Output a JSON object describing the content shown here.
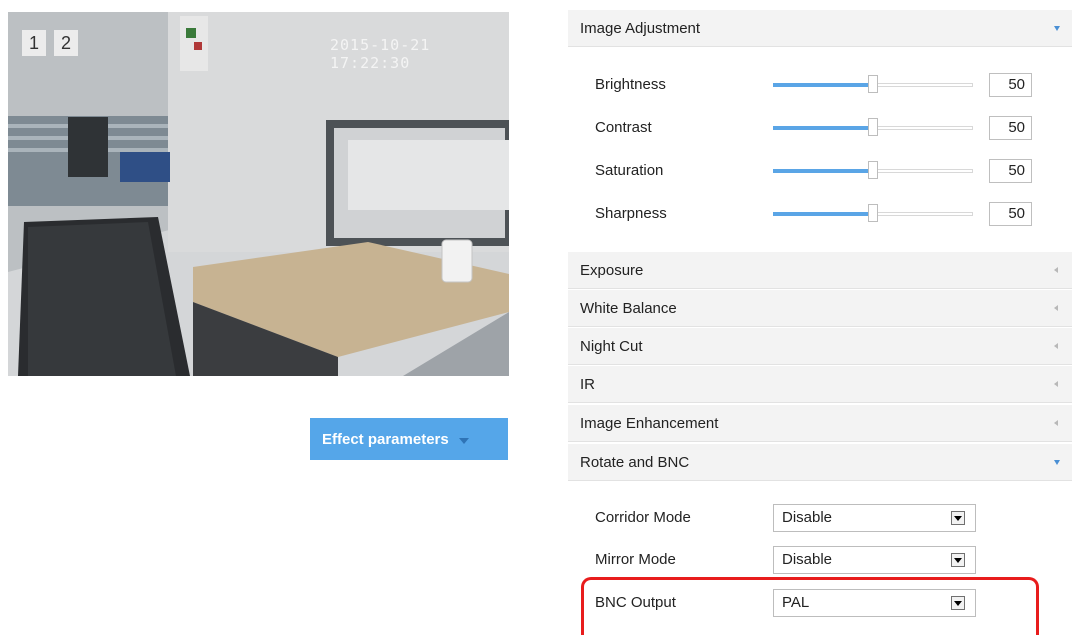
{
  "preview": {
    "channel_1": "1",
    "channel_2": "2",
    "timestamp": "2015-10-21 17:22:30"
  },
  "effect_button": {
    "label": "Effect parameters"
  },
  "image_adjustment": {
    "title": "Image Adjustment",
    "sliders": [
      {
        "label": "Brightness",
        "value": "50",
        "level": 50
      },
      {
        "label": "Contrast",
        "value": "50",
        "level": 50
      },
      {
        "label": "Saturation",
        "value": "50",
        "level": 50
      },
      {
        "label": "Sharpness",
        "value": "50",
        "level": 50
      }
    ]
  },
  "sections": [
    {
      "title": "Exposure"
    },
    {
      "title": "White Balance"
    },
    {
      "title": "Night Cut"
    },
    {
      "title": "IR"
    },
    {
      "title": "Image Enhancement"
    }
  ],
  "rotate_bnc": {
    "title": "Rotate and BNC",
    "rows": [
      {
        "label": "Corridor Mode",
        "value": "Disable"
      },
      {
        "label": "Mirror Mode",
        "value": "Disable"
      },
      {
        "label": "BNC Output",
        "value": "PAL"
      }
    ]
  },
  "colors": {
    "accent": "#55a6e9",
    "highlight": "#e81c1c",
    "header_bg": "#f3f3f3"
  },
  "icons": {
    "expanded": "chevron-down-icon",
    "collapsed": "chevron-left-icon",
    "dropdown": "dropdown-arrow-icon"
  }
}
